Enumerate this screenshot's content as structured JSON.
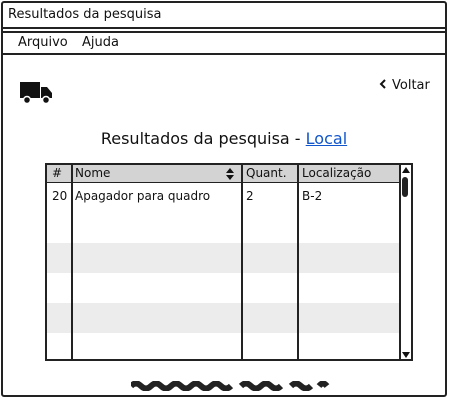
{
  "window": {
    "title": "Resultados da pesquisa"
  },
  "menu": {
    "items": [
      {
        "label": "Arquivo"
      },
      {
        "label": "Ajuda"
      }
    ]
  },
  "nav": {
    "back_label": "Voltar"
  },
  "heading": {
    "prefix": "Resultados da pesquisa - ",
    "link": "Local"
  },
  "table": {
    "columns": [
      "#",
      "Nome",
      "Quant.",
      "Localização"
    ],
    "rows": [
      {
        "num": "20",
        "name": "Apagador para quadro",
        "qty": "2",
        "location": "B-2"
      }
    ]
  },
  "icons": {
    "truck": "truck-icon",
    "back": "chevron-left-icon",
    "sort": "sort-icon",
    "scroll_up": "arrow-up-icon",
    "scroll_down": "arrow-down-icon"
  },
  "colors": {
    "link": "#1155cc",
    "header": "#d3d3d3",
    "stripe": "#ececec",
    "border": "#222222"
  }
}
